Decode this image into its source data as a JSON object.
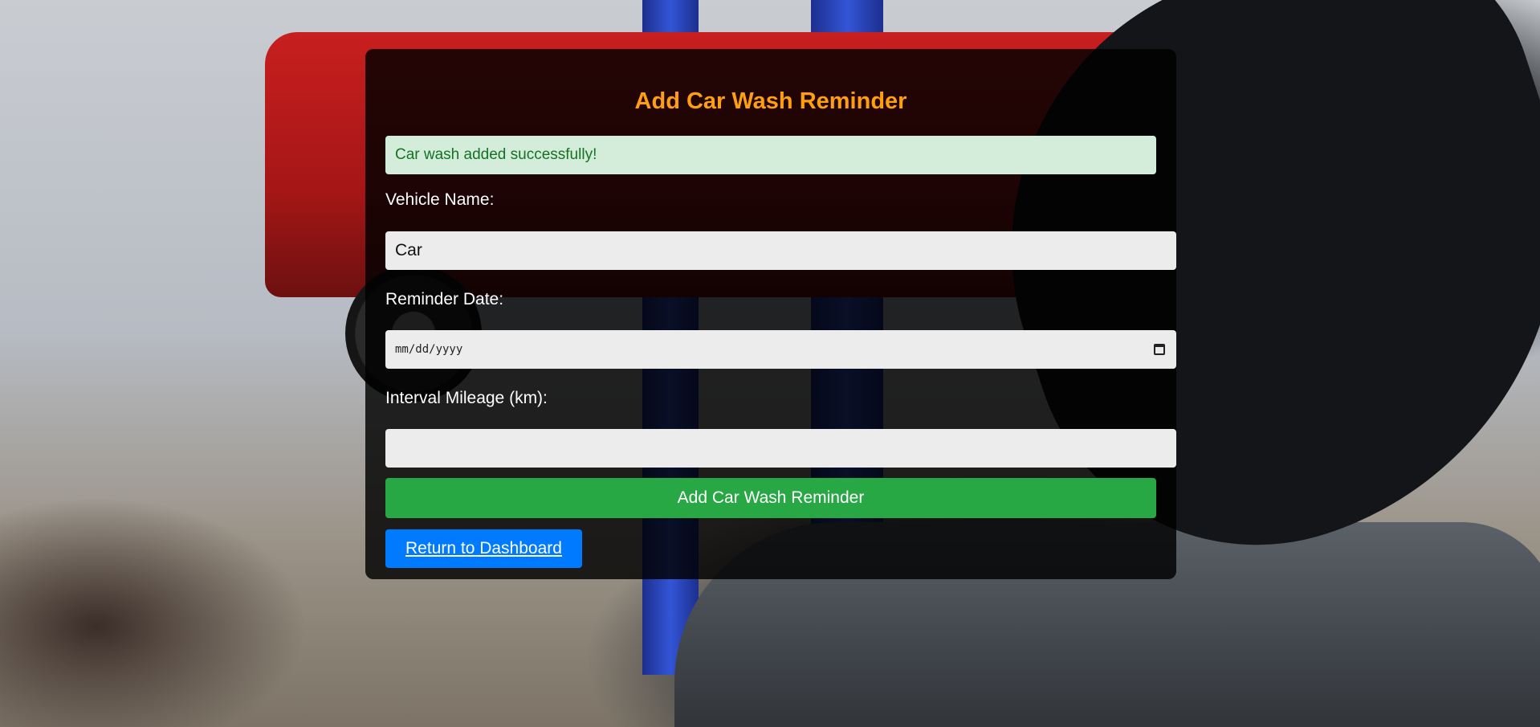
{
  "page": {
    "title": "Add Car Wash Reminder"
  },
  "alert": {
    "success_text": "Car wash added successfully!"
  },
  "form": {
    "vehicle_name_label": "Vehicle Name:",
    "vehicle_name_value": "Car",
    "reminder_date_label": "Reminder Date:",
    "reminder_date_placeholder": "mm/dd/yyyy",
    "interval_mileage_label": "Interval Mileage (km):",
    "interval_mileage_value": "",
    "submit_label": "Add Car Wash Reminder"
  },
  "nav": {
    "return_label": "Return to Dashboard"
  },
  "icons": {
    "date_picker": "calendar-icon"
  },
  "colors": {
    "title": "#ff9f0f",
    "success_bg": "#d4edda",
    "success_text": "#157224",
    "submit": "#28a745",
    "return": "#007bff"
  }
}
